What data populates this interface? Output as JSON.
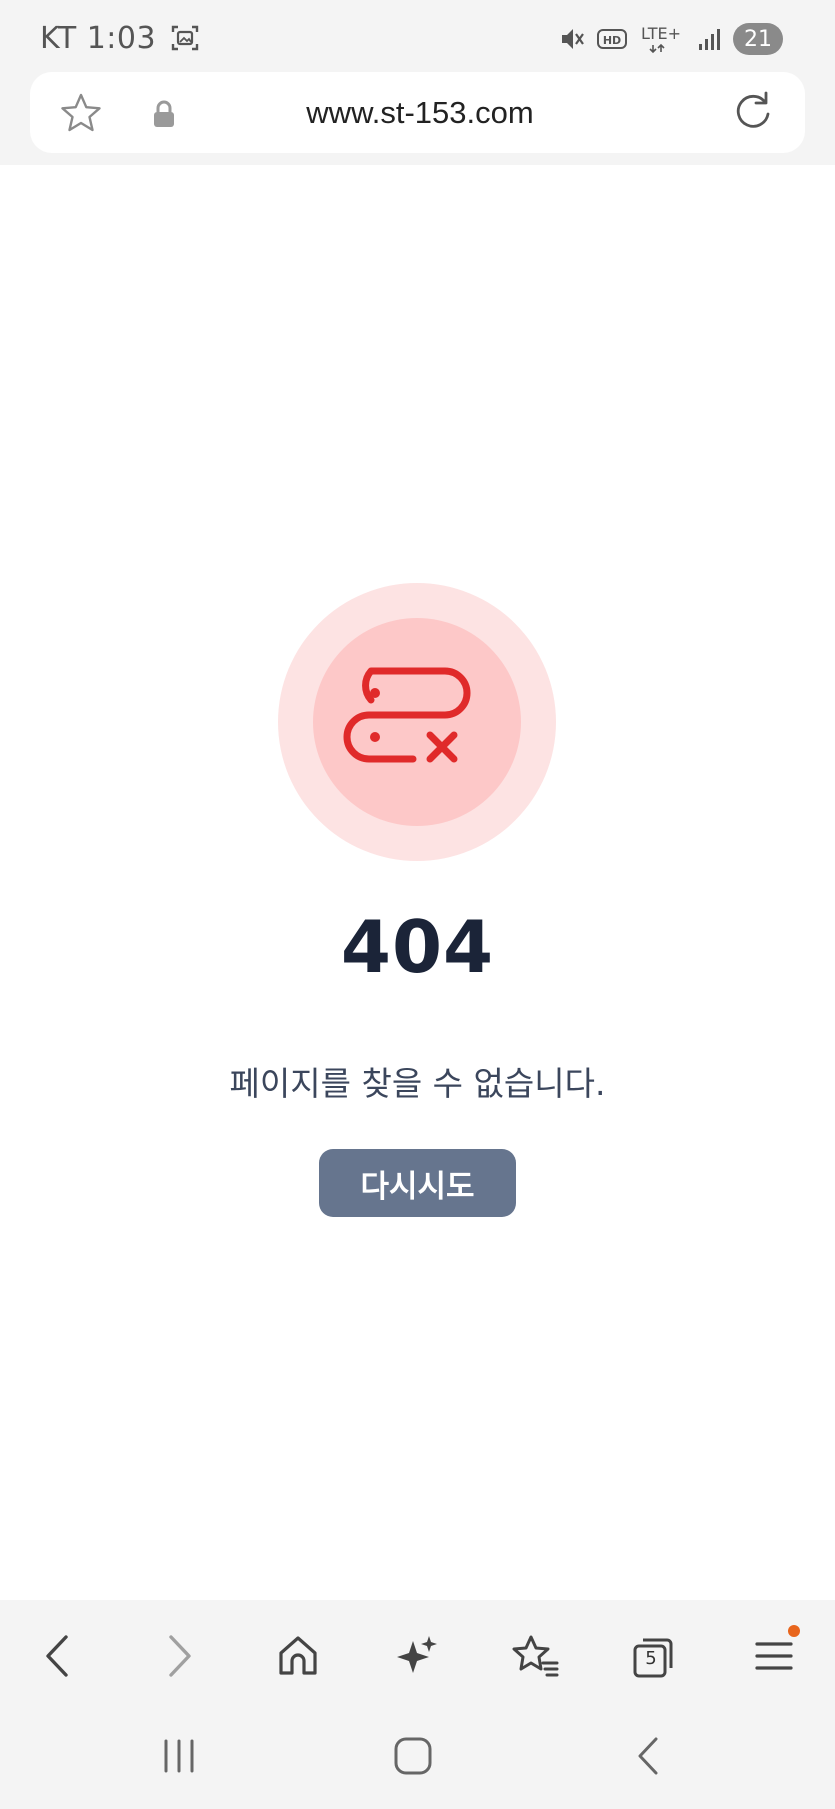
{
  "status_bar": {
    "carrier_time": "KT 1:03",
    "network": "LTE+",
    "hd": "HD",
    "battery": "21"
  },
  "address_bar": {
    "url": "www.st-153.com"
  },
  "error_page": {
    "code": "404",
    "message": "페이지를 찾을 수 없습니다.",
    "retry_label": "다시시도"
  },
  "toolbar": {
    "tabs_count": "5"
  },
  "colors": {
    "badge_outer": "#fde3e3",
    "badge_inner": "#fdc8c8",
    "error_icon": "#e02a2a",
    "button_bg": "#66758e",
    "code_text": "#1b2438",
    "notification_dot": "#e8651c"
  }
}
